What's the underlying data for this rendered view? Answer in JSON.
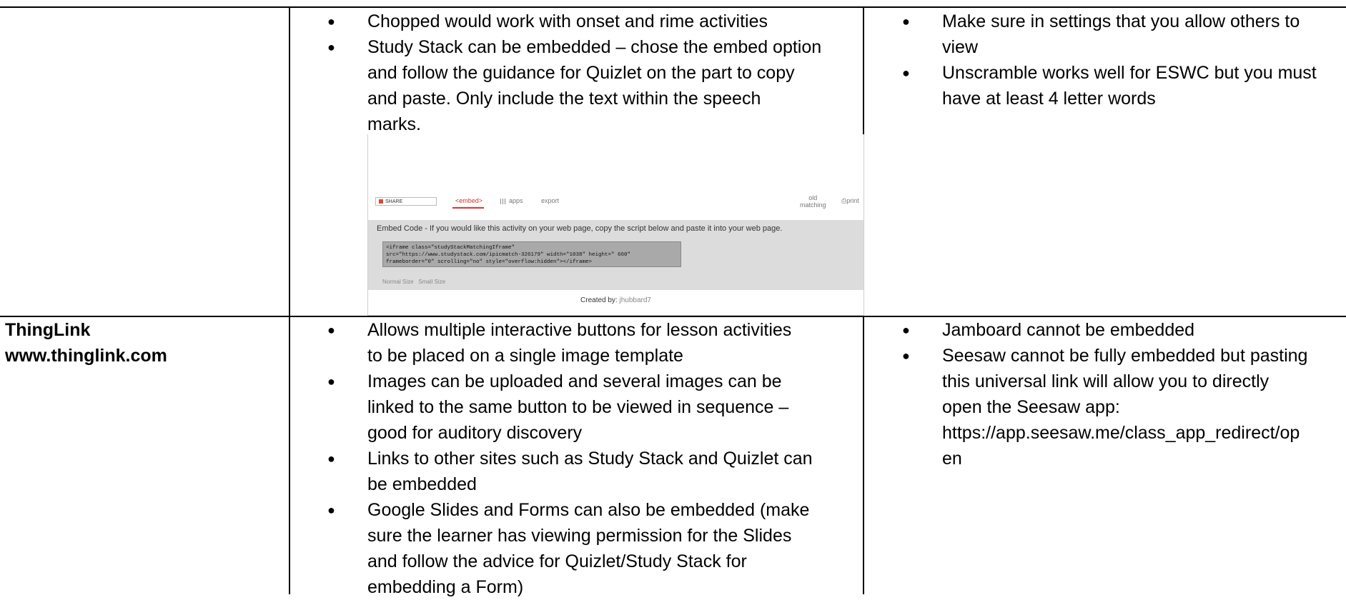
{
  "table": {
    "row1": {
      "col2_bullets": [
        [
          "Chopped would work with onset and rime activities"
        ],
        [
          "Study Stack can be embedded – chose the embed option",
          "and follow the guidance for Quizlet on the part to copy",
          "and paste. Only include the text within the speech",
          "marks."
        ]
      ],
      "col3_bullets": [
        [
          "Make sure in settings that you allow others to",
          "view"
        ],
        [
          "Unscramble works well for ESWC but you must",
          "have at least 4 letter words"
        ]
      ],
      "screenshot": {
        "share_label": "SHARE",
        "tab_embed": "<embed>",
        "tab_apps": "apps",
        "tab_export": "export",
        "tab_old_matching_1": "old",
        "tab_old_matching_2": "matching",
        "tab_print": "print",
        "embed_heading": "Embed Code - If you would like this activity on your web page, copy the script below and paste it into your web page.",
        "embed_code": "<iframe class=\"studyStackMatchingIframe\"\nsrc=\"https://www.studystack.com/ipicmatch-326179\" width=\"1038\" height=\" 660\"\nframeborder=\"0\" scrolling=\"no\" style=\"overflow:hidden\"></iframe>",
        "normal_size": "Normal Size",
        "small_size": "Small Size",
        "created_by_label": "Created by:",
        "created_by_user": "jhubbard7"
      }
    },
    "row2": {
      "col1_title": "ThingLink",
      "col1_url": "www.thinglink.com",
      "col2_bullets": [
        [
          "Allows multiple interactive buttons for lesson activities",
          "to be placed on a single image template"
        ],
        [
          "Images can be uploaded and several images can be",
          "linked to the same button to be viewed in sequence –",
          "good for auditory discovery"
        ],
        [
          "Links to other sites such as Study Stack and Quizlet can",
          "be embedded"
        ],
        [
          "Google Slides and Forms can also be embedded (make",
          "sure the learner has viewing permission for the Slides",
          "and follow the advice for Quizlet/Study Stack for",
          "embedding a Form)"
        ]
      ],
      "col3_bullets": [
        [
          "Jamboard cannot be embedded"
        ],
        [
          "Seesaw cannot be fully embedded but pasting",
          "this universal link will allow you to directly",
          "open the Seesaw app:",
          "https://app.seesaw.me/class_app_redirect/op",
          "en"
        ]
      ]
    }
  }
}
